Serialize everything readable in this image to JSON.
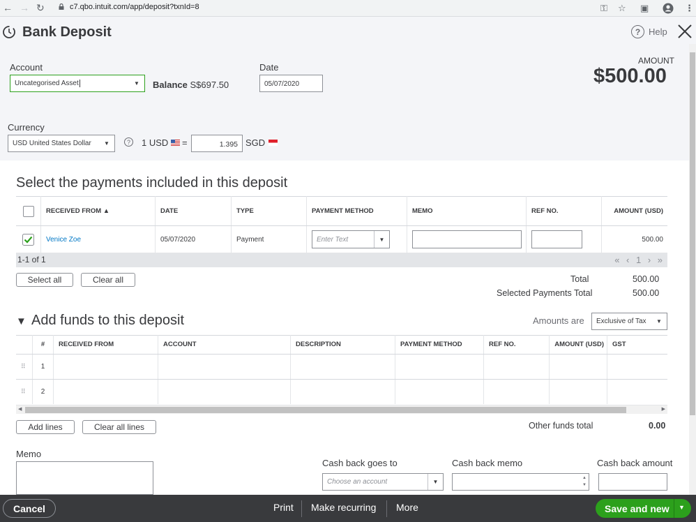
{
  "browser": {
    "url": "c7.qbo.intuit.com/app/deposit?txnId=8"
  },
  "header": {
    "title": "Bank Deposit",
    "help_label": "Help"
  },
  "form": {
    "account_label": "Account",
    "account_value": "Uncategorised Asset",
    "balance_label": "Balance",
    "balance_value": "S$697.50",
    "date_label": "Date",
    "date_value": "05/07/2020",
    "amount_label": "AMOUNT",
    "amount_value": "$500.00",
    "currency_label": "Currency",
    "currency_value": "USD United States Dollar",
    "rate_prefix": "1 USD",
    "rate_equals": "=",
    "rate_value": "1.395",
    "rate_suffix": "SGD"
  },
  "payments": {
    "heading": "Select the payments included in this deposit",
    "columns": [
      "RECEIVED FROM ▲",
      "DATE",
      "TYPE",
      "PAYMENT METHOD",
      "MEMO",
      "REF NO.",
      "AMOUNT (USD)"
    ],
    "rows": [
      {
        "received_from": "Venice Zoe",
        "date": "05/07/2020",
        "type": "Payment",
        "payment_method_placeholder": "Enter Text",
        "amount": "500.00"
      }
    ],
    "pager_text": "1-1 of 1",
    "pager_nav": "« ‹ 1 › »",
    "select_all": "Select all",
    "clear_all": "Clear all",
    "total_label": "Total",
    "total_value": "500.00",
    "selected_total_label": "Selected Payments Total",
    "selected_total_value": "500.00"
  },
  "funds": {
    "heading": "Add funds to this deposit",
    "amounts_are_label": "Amounts are",
    "amounts_are_value": "Exclusive of Tax",
    "columns": [
      "#",
      "RECEIVED FROM",
      "ACCOUNT",
      "DESCRIPTION",
      "PAYMENT METHOD",
      "REF NO.",
      "AMOUNT (USD)",
      "GST"
    ],
    "rows": [
      {
        "num": "1"
      },
      {
        "num": "2"
      }
    ],
    "add_lines": "Add lines",
    "clear_all_lines": "Clear all lines",
    "other_total_label": "Other funds total",
    "other_total_value": "0.00"
  },
  "bottom": {
    "memo_label": "Memo",
    "cash_back_goes_to_label": "Cash back goes to",
    "cash_back_goes_to_placeholder": "Choose an account",
    "cash_back_memo_label": "Cash back memo",
    "cash_back_amount_label": "Cash back amount"
  },
  "footer": {
    "cancel": "Cancel",
    "print": "Print",
    "make_recurring": "Make recurring",
    "more": "More",
    "save_and_new": "Save and new"
  },
  "colors": {
    "accent": "#2ca01c",
    "link": "#0077c5",
    "footer_bg": "#393a3d",
    "header_bg": "#f4f5f8"
  }
}
